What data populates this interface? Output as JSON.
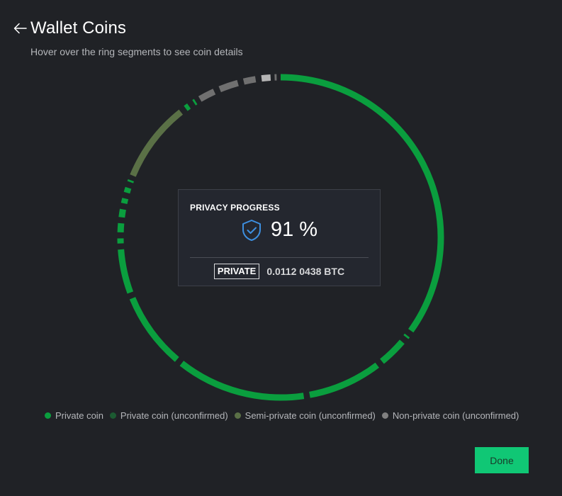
{
  "header": {
    "title": "Wallet Coins",
    "subtitle": "Hover over the ring segments to see coin details"
  },
  "card": {
    "label": "PRIVACY PROGRESS",
    "percent": "91 %",
    "badge": "PRIVATE",
    "amount": "0.0112 0438 BTC"
  },
  "legend": [
    {
      "label": "Private coin",
      "color": "#0a9e3e"
    },
    {
      "label": "Private coin (unconfirmed)",
      "color": "#1c5b32"
    },
    {
      "label": "Semi-private coin (unconfirmed)",
      "color": "#5a7046"
    },
    {
      "label": "Non-private coin (unconfirmed)",
      "color": "#808080"
    }
  ],
  "colors": {
    "private": "#0a9e3e",
    "semi": "#5a7046",
    "nonprivate": "#707070",
    "nonprivate_light": "#b5b5b5",
    "shield": "#3d8fe0",
    "done": "#10c775"
  },
  "ring_segments": [
    {
      "type": "private",
      "start": 0.0,
      "end": 34.9
    },
    {
      "type": "private",
      "start": 35.5,
      "end": 35.7
    },
    {
      "type": "private",
      "start": 36.3,
      "end": 39.1
    },
    {
      "type": "private",
      "start": 39.7,
      "end": 47.1
    },
    {
      "type": "private",
      "start": 47.7,
      "end": 60.6
    },
    {
      "type": "private",
      "start": 61.2,
      "end": 68.8
    },
    {
      "type": "private",
      "start": 69.4,
      "end": 73.8
    },
    {
      "type": "private",
      "start": 74.4,
      "end": 74.9
    },
    {
      "type": "private",
      "start": 75.5,
      "end": 76.4
    },
    {
      "type": "private",
      "start": 77.0,
      "end": 77.8
    },
    {
      "type": "private",
      "start": 78.4,
      "end": 78.9
    },
    {
      "type": "private",
      "start": 79.5,
      "end": 80.0
    },
    {
      "type": "private",
      "start": 80.6,
      "end": 80.8
    },
    {
      "type": "semi",
      "start": 81.3,
      "end": 89.3
    },
    {
      "type": "private",
      "start": 89.9,
      "end": 90.3
    },
    {
      "type": "private",
      "start": 90.9,
      "end": 91.1
    },
    {
      "type": "nonprivate",
      "start": 91.6,
      "end": 93.2
    },
    {
      "type": "nonprivate",
      "start": 93.8,
      "end": 95.7
    },
    {
      "type": "nonprivate",
      "start": 96.3,
      "end": 97.5
    },
    {
      "type": "nonprivate_light",
      "start": 98.1,
      "end": 99.0
    },
    {
      "type": "nonprivate",
      "start": 99.4,
      "end": 99.6
    }
  ]
}
